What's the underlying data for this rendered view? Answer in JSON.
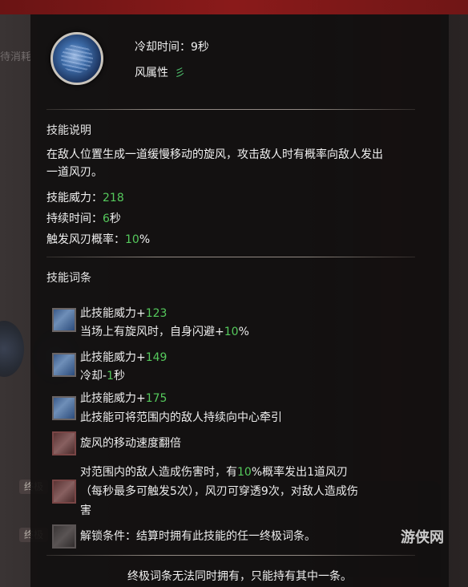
{
  "background": {
    "left_text": "待消耗",
    "badge_1": "终极",
    "badge_2": "终极"
  },
  "skill": {
    "icon": "wind-vortex-skill-icon",
    "cooldown": "冷却时间：9秒",
    "attribute": "风属性",
    "attribute_icon": "wind-icon",
    "attribute_glyph": "彡"
  },
  "description": {
    "title": "技能说明",
    "line1": "在敌人位置生成一道缓慢移动的旋风，攻击敌人时有概率向敌人发出",
    "line2": "一道风刃。",
    "power_label": "技能威力：",
    "power_value": "218",
    "duration_label": "持续时间：",
    "duration_value": "6",
    "duration_unit": "秒",
    "chance_label": "触发风刃概率：",
    "chance_value": "10",
    "chance_unit": "%"
  },
  "entries": {
    "title": "技能词条",
    "e1_a_prefix": "此技能威力+",
    "e1_a_value": "123",
    "e1_b_prefix": "当场上有旋风时，自身闪避+",
    "e1_b_value": "10",
    "e1_b_suffix": "%",
    "e2_a_prefix": "此技能威力+",
    "e2_a_value": "149",
    "e2_b_prefix": "冷却-",
    "e2_b_value": "1",
    "e2_b_suffix": "秒",
    "e3_a_prefix": "此技能威力+",
    "e3_a_value": "175",
    "e3_b": "此技能可将范围内的敌人持续向中心牵引",
    "e4": "旋风的移动速度翻倍",
    "e5_a_prefix": "对范围内的敌人造成伤害时，有",
    "e5_a_value": "10",
    "e5_a_suffix": "%概率发出1道风刃",
    "e5_b": "（每秒最多可触发5次），风刃可穿透9次，对敌人造成伤",
    "e5_c": "害",
    "e6": "解锁条件：结算时拥有此技能的任一终极词条。"
  },
  "footer": "终极词条无法同时拥有，只能持有其中一条。",
  "watermark": "游侠网"
}
